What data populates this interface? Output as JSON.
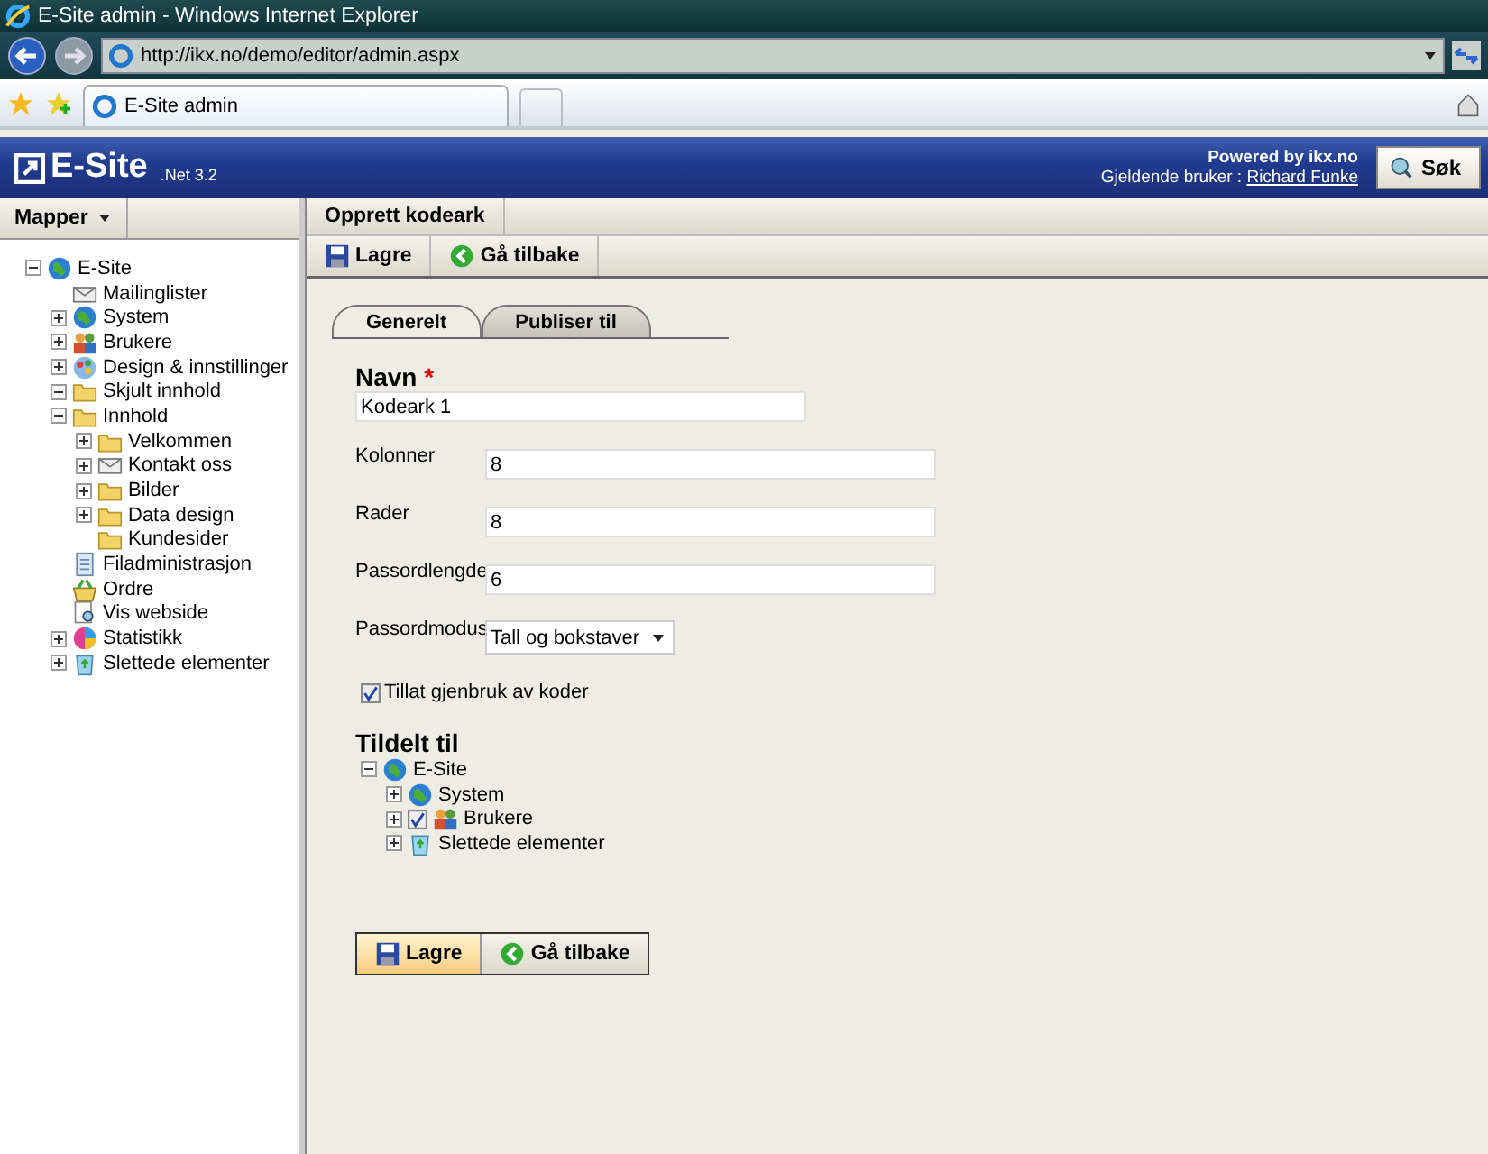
{
  "window": {
    "title": "E-Site admin - Windows Internet Explorer"
  },
  "browser": {
    "address": "http://ikx.no/demo/editor/admin.aspx",
    "tab": "E-Site admin"
  },
  "header": {
    "logo": "E-Site",
    "version": ".Net 3.2",
    "powered": "Powered by ikx.no",
    "user_label": "Gjeldende bruker :",
    "user": "Richard Funke",
    "search_button": "Søk"
  },
  "sidebar": {
    "menu": "Mapper",
    "tree": [
      {
        "label": "E-Site",
        "kind": "globe",
        "expanded": true,
        "children": [
          {
            "label": "Mailinglister",
            "kind": "mail"
          },
          {
            "label": "System",
            "kind": "globe",
            "expanded": false
          },
          {
            "label": "Brukere",
            "kind": "people",
            "expanded": false
          },
          {
            "label": "Design & innstillinger",
            "kind": "design",
            "expanded": false
          },
          {
            "label": "Skjult innhold",
            "kind": "folder",
            "expanded": true
          },
          {
            "label": "Innhold",
            "kind": "folder",
            "expanded": true,
            "children": [
              {
                "label": "Velkommen",
                "kind": "folder",
                "expanded": false
              },
              {
                "label": "Kontakt oss",
                "kind": "mail",
                "expanded": false
              },
              {
                "label": "Bilder",
                "kind": "folder",
                "expanded": false
              },
              {
                "label": "Data design",
                "kind": "folder",
                "expanded": false
              },
              {
                "label": "Kundesider",
                "kind": "folder"
              }
            ]
          },
          {
            "label": "Filadministrasjon",
            "kind": "files"
          },
          {
            "label": "Ordre",
            "kind": "basket"
          },
          {
            "label": "Vis webside",
            "kind": "preview"
          },
          {
            "label": "Statistikk",
            "kind": "stats",
            "expanded": false
          },
          {
            "label": "Slettede elementer",
            "kind": "recycle",
            "expanded": false
          }
        ]
      }
    ]
  },
  "panel": {
    "title": "Opprett kodeark",
    "toolbar": [
      "Lagre",
      "Gå tilbake"
    ],
    "tabs": [
      {
        "label": "Generelt",
        "selected": true
      },
      {
        "label": "Publiser til",
        "selected": false
      }
    ],
    "name_label": "Navn",
    "required_mark": "*",
    "name_value": "Kodeark 1",
    "fields": [
      {
        "label": "Kolonner",
        "value": "8",
        "kind": "text"
      },
      {
        "label": "Rader",
        "value": "8",
        "kind": "text"
      },
      {
        "label": "Passordlengde",
        "value": "6",
        "kind": "text"
      },
      {
        "label": "Passordmodus",
        "value": "Tall og bokstaver",
        "kind": "select"
      }
    ],
    "reuse": {
      "label": "Tillat gjenbruk av koder",
      "checked": true
    },
    "assigned_title": "Tildelt til",
    "assigned": [
      {
        "label": "E-Site",
        "kind": "globe",
        "expanded": true,
        "checked": false,
        "children": [
          {
            "label": "System",
            "kind": "globe",
            "expanded": false,
            "checked": false
          },
          {
            "label": "Brukere",
            "kind": "people",
            "expanded": false,
            "checked": true
          },
          {
            "label": "Slettede elementer",
            "kind": "recycle",
            "expanded": false,
            "checked": false
          }
        ]
      }
    ],
    "bottom_buttons": [
      "Lagre",
      "Gå tilbake"
    ]
  }
}
